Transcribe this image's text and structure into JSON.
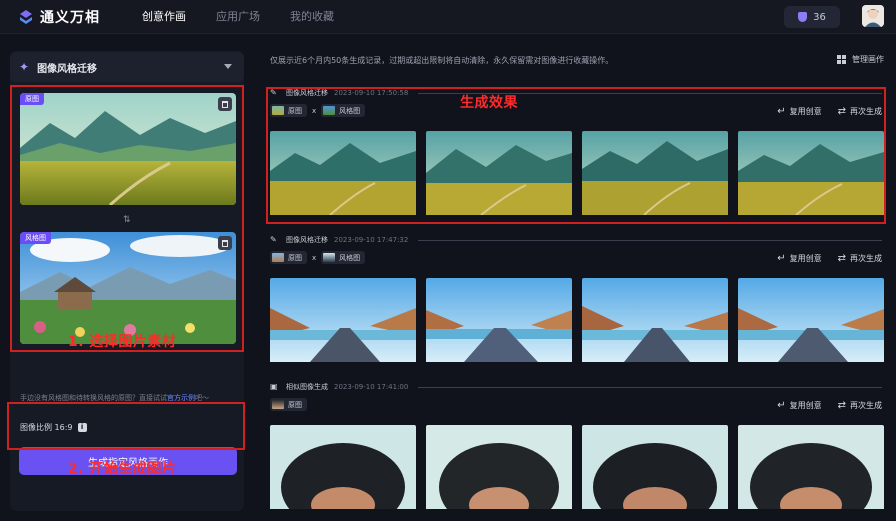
{
  "app": {
    "title": "通义万相"
  },
  "nav": {
    "items": [
      "创意作画",
      "应用广场",
      "我的收藏"
    ],
    "active_index": 0
  },
  "header": {
    "credits": "36"
  },
  "sidebar": {
    "mode_label": "图像风格迁移",
    "source_tag": "原图",
    "style_tag": "风格图",
    "hint_text": "手边没有风格图和待转换风格的原图？直接试试",
    "hint_link": "官方示例",
    "hint_suffix": "吧～",
    "ratio_label": "图像比例 16:9",
    "info_icon_text": "i",
    "generate_button": "生成指定风格画作"
  },
  "annotations": {
    "step1": "1. 选择图片素材",
    "step2": "2. 开始生成图片",
    "result": "生成效果"
  },
  "main": {
    "notice": "仅展示近6个月内50条生成记录，过期或超出限制将自动清除，永久保留需对图像进行收藏操作。",
    "manage_label": "管理画作",
    "reuse_label": "复用创意",
    "regen_label": "再次生成",
    "groups": [
      {
        "type_label": "图像风格迁移",
        "time": "2023-09-10 17:50:58",
        "chip1": "原图",
        "sep": "x",
        "chip2": "风格图"
      },
      {
        "type_label": "图像风格迁移",
        "time": "2023-09-10 17:47:32",
        "chip1": "原图",
        "sep": "x",
        "chip2": "风格图"
      },
      {
        "type_label": "相似图像生成",
        "time": "2023-09-10 17:41:00",
        "chip1": "原图"
      }
    ]
  },
  "colors": {
    "accent": "#6a52f2",
    "annotation_red": "#d21f1f",
    "background": "#10131b"
  },
  "icons": [
    "logo-icon",
    "shield-icon",
    "wand-icon",
    "chevron-down-icon",
    "trash-icon",
    "swap-icon",
    "info-icon",
    "grid-icon",
    "reuse-icon",
    "regen-icon"
  ]
}
